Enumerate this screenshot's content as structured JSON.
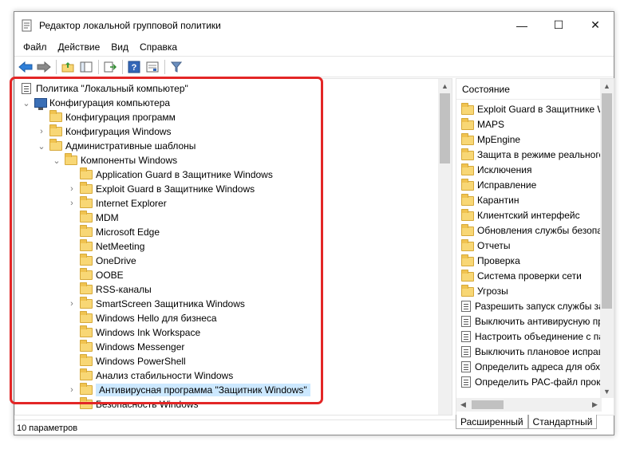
{
  "window": {
    "title": "Редактор локальной групповой политики",
    "controls": {
      "minimize": "—",
      "maximize": "☐",
      "close": "✕"
    }
  },
  "menu": [
    "Файл",
    "Действие",
    "Вид",
    "Справка"
  ],
  "toolbar": {
    "icons": [
      "back-icon",
      "forward-icon",
      "up-folder-icon",
      "show-hide-tree-icon",
      "export-list-icon",
      "help-icon",
      "properties-icon",
      "filter-icon"
    ]
  },
  "tree": {
    "root": "Политика \"Локальный компьютер\"",
    "computer_config": "Конфигурация компьютера",
    "program_config": "Конфигурация программ",
    "windows_config": "Конфигурация Windows",
    "admin_templates": "Административные шаблоны",
    "windows_components": "Компоненты Windows",
    "items": [
      {
        "label": "Application Guard в Защитнике Windows",
        "expandable": false
      },
      {
        "label": "Exploit Guard в Защитнике Windows",
        "expandable": true
      },
      {
        "label": "Internet Explorer",
        "expandable": true
      },
      {
        "label": "MDM",
        "expandable": false
      },
      {
        "label": "Microsoft Edge",
        "expandable": false
      },
      {
        "label": "NetMeeting",
        "expandable": false
      },
      {
        "label": "OneDrive",
        "expandable": false
      },
      {
        "label": "OOBE",
        "expandable": false
      },
      {
        "label": "RSS-каналы",
        "expandable": false
      },
      {
        "label": "SmartScreen Защитника Windows",
        "expandable": true
      },
      {
        "label": "Windows Hello для бизнеса",
        "expandable": false
      },
      {
        "label": "Windows Ink Workspace",
        "expandable": false
      },
      {
        "label": "Windows Messenger",
        "expandable": false
      },
      {
        "label": "Windows PowerShell",
        "expandable": false
      },
      {
        "label": "Анализ стабильности Windows",
        "expandable": false
      },
      {
        "label": "Антивирусная программа \"Защитник Windows\"",
        "expandable": true,
        "selected": true
      },
      {
        "label": "Безопасность Windows",
        "expandable": false
      }
    ]
  },
  "right_pane": {
    "header": "Состояние",
    "items": [
      {
        "label": "Exploit Guard в Защитнике Windows",
        "icon": "folder-icon"
      },
      {
        "label": "MAPS",
        "icon": "folder-icon"
      },
      {
        "label": "MpEngine",
        "icon": "folder-icon"
      },
      {
        "label": "Защита в режиме реального времени",
        "icon": "folder-icon"
      },
      {
        "label": "Исключения",
        "icon": "folder-icon"
      },
      {
        "label": "Исправление",
        "icon": "folder-icon"
      },
      {
        "label": "Карантин",
        "icon": "folder-icon"
      },
      {
        "label": "Клиентский интерфейс",
        "icon": "folder-icon"
      },
      {
        "label": "Обновления службы безопасности",
        "icon": "folder-icon"
      },
      {
        "label": "Отчеты",
        "icon": "folder-icon"
      },
      {
        "label": "Проверка",
        "icon": "folder-icon"
      },
      {
        "label": "Система проверки сети",
        "icon": "folder-icon"
      },
      {
        "label": "Угрозы",
        "icon": "folder-icon"
      },
      {
        "label": "Разрешить запуск службы защиты",
        "icon": "policy-icon"
      },
      {
        "label": "Выключить антивирусную программу",
        "icon": "policy-icon"
      },
      {
        "label": "Настроить объединение с папками",
        "icon": "policy-icon"
      },
      {
        "label": "Выключить плановое исправление",
        "icon": "policy-icon"
      },
      {
        "label": "Определить адреса для обхода",
        "icon": "policy-icon"
      },
      {
        "label": "Определить PAC-файл прокси",
        "icon": "policy-icon"
      }
    ],
    "tabs": [
      "Расширенный",
      "Стандартный"
    ]
  },
  "status": "10 параметров",
  "colors": {
    "selection": "#cce8ff",
    "highlight_frame": "#e32626",
    "folder": "#f8d775"
  }
}
